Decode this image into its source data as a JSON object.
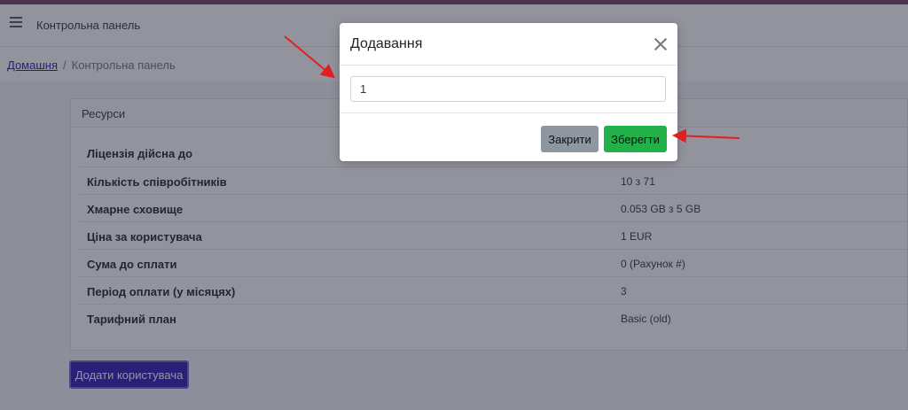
{
  "navbar": {
    "title": "Контрольна панель"
  },
  "breadcrumb": {
    "home": "Домашня",
    "current": "Контрольна панель"
  },
  "resources": {
    "header": "Ресурси",
    "rows": [
      {
        "label": "Ліцензія дійсна до",
        "value": ""
      },
      {
        "label": "Кількість співробітників",
        "value": "10 з 71"
      },
      {
        "label": "Хмарне сховище",
        "value": "0.053 GB з 5 GB"
      },
      {
        "label": "Ціна за користувача",
        "value": "1 EUR"
      },
      {
        "label": "Сума до сплати",
        "value": "0 (Рахунок #)"
      },
      {
        "label": "Період оплати (у місяцях)",
        "value": "3"
      },
      {
        "label": "Тарифний план",
        "value": "Basic (old)"
      }
    ]
  },
  "add_user_label": "Додати користувача",
  "modal": {
    "title": "Додавання",
    "input_value": "1",
    "close_label": "Закрити",
    "save_label": "Зберегти"
  },
  "colors": {
    "primary": "#2b1bb5",
    "save": "#22b04a",
    "secondary": "#8e96a0",
    "annotation_arrow": "#e02020"
  }
}
